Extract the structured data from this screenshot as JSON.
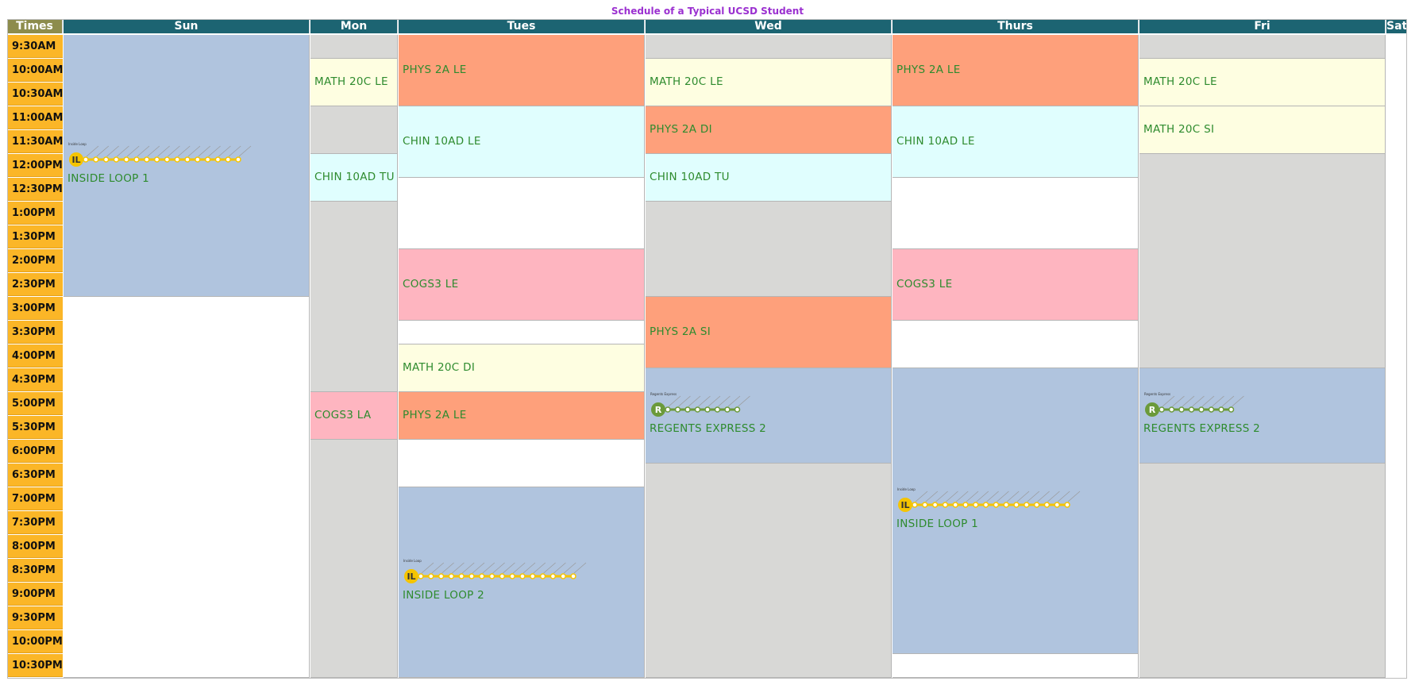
{
  "title": "Schedule of a Typical UCSD Student",
  "headers": [
    "Times",
    "Sun",
    "Mon",
    "Tues",
    "Wed",
    "Thurs",
    "Fri",
    "Sat"
  ],
  "times": [
    "9:30AM",
    "10:00AM",
    "10:30AM",
    "11:00AM",
    "11:30AM",
    "12:00PM",
    "12:30PM",
    "1:00PM",
    "1:30PM",
    "2:00PM",
    "2:30PM",
    "3:00PM",
    "3:30PM",
    "4:00PM",
    "4:30PM",
    "5:00PM",
    "5:30PM",
    "6:00PM",
    "6:30PM",
    "7:00PM",
    "7:30PM",
    "8:00PM",
    "8:30PM",
    "9:00PM",
    "9:30PM",
    "10:00PM",
    "10:30PM"
  ],
  "colors": {
    "header": "#1c6472",
    "times_header": "#8d8c4c",
    "time_cell": "#fbb627",
    "phys": "#fea07b",
    "math": "#fefee1",
    "chin": "#e0fefe",
    "cogs": "#feb5c0",
    "bus": "#b0c4de",
    "unavailable": "#d8d8d6",
    "free": "#ffffff",
    "label_text": "#2e8b2e"
  },
  "events": {
    "sun": [
      {
        "label": "INSIDE LOOP 1",
        "kind": "bus",
        "route": "IL"
      },
      {
        "label": "",
        "kind": "free"
      }
    ],
    "mon": [
      {
        "label": "",
        "kind": "unavailable"
      },
      {
        "label": "MATH 20C LE",
        "kind": "math"
      },
      {
        "label": "",
        "kind": "unavailable"
      },
      {
        "label": "CHIN 10AD TU",
        "kind": "chin"
      },
      {
        "label": "",
        "kind": "unavailable"
      },
      {
        "label": "COGS3 LA",
        "kind": "cogs"
      },
      {
        "label": "",
        "kind": "unavailable"
      }
    ],
    "tues": [
      {
        "label": "PHYS 2A LE",
        "kind": "phys"
      },
      {
        "label": "CHIN 10AD LE",
        "kind": "chin"
      },
      {
        "label": "",
        "kind": "free"
      },
      {
        "label": "COGS3 LE",
        "kind": "cogs"
      },
      {
        "label": "",
        "kind": "free"
      },
      {
        "label": "MATH 20C DI",
        "kind": "math"
      },
      {
        "label": "PHYS 2A LE",
        "kind": "phys"
      },
      {
        "label": "",
        "kind": "free"
      },
      {
        "label": "INSIDE LOOP 2",
        "kind": "bus",
        "route": "IL"
      }
    ],
    "wed": [
      {
        "label": "",
        "kind": "unavailable"
      },
      {
        "label": "MATH 20C LE",
        "kind": "math"
      },
      {
        "label": "PHYS 2A DI",
        "kind": "phys"
      },
      {
        "label": "CHIN 10AD TU",
        "kind": "chin"
      },
      {
        "label": "",
        "kind": "unavailable"
      },
      {
        "label": "PHYS 2A SI",
        "kind": "phys"
      },
      {
        "label": "REGENTS EXPRESS 2",
        "kind": "bus",
        "route": "R"
      },
      {
        "label": "",
        "kind": "unavailable"
      }
    ],
    "thurs": [
      {
        "label": "PHYS 2A LE",
        "kind": "phys"
      },
      {
        "label": "CHIN 10AD LE",
        "kind": "chin"
      },
      {
        "label": "",
        "kind": "free"
      },
      {
        "label": "COGS3 LE",
        "kind": "cogs"
      },
      {
        "label": "",
        "kind": "free"
      },
      {
        "label": "INSIDE LOOP 1",
        "kind": "bus",
        "route": "IL"
      },
      {
        "label": "",
        "kind": "free"
      }
    ],
    "fri": [
      {
        "label": "",
        "kind": "unavailable"
      },
      {
        "label": "MATH 20C LE",
        "kind": "math"
      },
      {
        "label": "MATH 20C SI",
        "kind": "math"
      },
      {
        "label": "",
        "kind": "unavailable"
      },
      {
        "label": "REGENTS EXPRESS 2",
        "kind": "bus",
        "route": "R"
      },
      {
        "label": "",
        "kind": "unavailable"
      }
    ],
    "sat": []
  },
  "event_spans": {
    "sun": [
      [
        0,
        11
      ],
      [
        11,
        27
      ]
    ],
    "mon": [
      [
        0,
        1
      ],
      [
        1,
        3
      ],
      [
        3,
        5
      ],
      [
        5,
        7
      ],
      [
        7,
        15
      ],
      [
        15,
        17
      ],
      [
        17,
        27
      ]
    ],
    "tues": [
      [
        0,
        3
      ],
      [
        3,
        6
      ],
      [
        6,
        9
      ],
      [
        9,
        12
      ],
      [
        12,
        13
      ],
      [
        13,
        15
      ],
      [
        15,
        17
      ],
      [
        17,
        19
      ],
      [
        19,
        27
      ]
    ],
    "wed": [
      [
        0,
        1
      ],
      [
        1,
        3
      ],
      [
        3,
        5
      ],
      [
        5,
        7
      ],
      [
        7,
        11
      ],
      [
        11,
        14
      ],
      [
        14,
        18
      ],
      [
        18,
        27
      ]
    ],
    "thurs": [
      [
        0,
        3
      ],
      [
        3,
        6
      ],
      [
        6,
        9
      ],
      [
        9,
        12
      ],
      [
        12,
        14
      ],
      [
        14,
        26
      ],
      [
        26,
        27
      ]
    ],
    "fri": [
      [
        0,
        1
      ],
      [
        1,
        3
      ],
      [
        3,
        5
      ],
      [
        5,
        14
      ],
      [
        14,
        18
      ],
      [
        18,
        27
      ]
    ],
    "sat": []
  },
  "route_badges": {
    "IL": {
      "text": "IL",
      "color": "#f5c400",
      "name": "Inside Loop",
      "stops": 16
    },
    "R": {
      "text": "R",
      "color": "#6b9a3a",
      "name": "Regents Express",
      "stops": 8
    }
  }
}
